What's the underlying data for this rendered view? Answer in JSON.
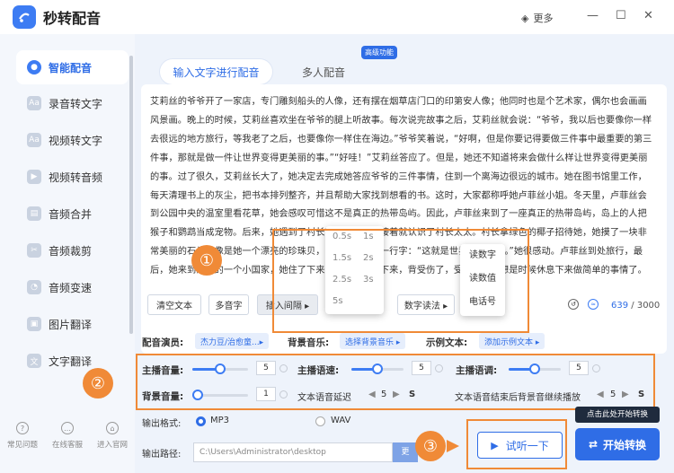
{
  "app": {
    "title": "秒转配音",
    "more_label": "更多",
    "win_controls": {
      "minimize": "—",
      "maximize": "☐",
      "close": "✕"
    }
  },
  "sidebar": {
    "items": [
      {
        "label": "智能配音",
        "icon": "mic-icon",
        "active": true
      },
      {
        "label": "录音转文字",
        "icon": "audio-text-icon"
      },
      {
        "label": "视频转文字",
        "icon": "video-text-icon"
      },
      {
        "label": "视频转音频",
        "icon": "video-audio-icon"
      },
      {
        "label": "音频合并",
        "icon": "merge-icon"
      },
      {
        "label": "音频裁剪",
        "icon": "scissors-icon"
      },
      {
        "label": "音频变速",
        "icon": "speed-icon"
      },
      {
        "label": "图片翻译",
        "icon": "image-translate-icon"
      },
      {
        "label": "文字翻译",
        "icon": "text-translate-icon"
      }
    ],
    "footer": [
      {
        "label": "常见问题",
        "icon": "question-icon"
      },
      {
        "label": "在线客服",
        "icon": "chat-icon"
      },
      {
        "label": "进入官网",
        "icon": "home-icon"
      }
    ]
  },
  "tabs": [
    {
      "label": "输入文字进行配音",
      "active": true
    },
    {
      "label": "多人配音"
    }
  ],
  "badge": "高级功能",
  "editor": {
    "text": "艾莉丝的爷爷开了一家店，专门雕刻船头的人像，还有摆在烟草店门口的印第安人像；他同时也是个艺术家，偶尔也会画画风景画。晚上的时候，艾莉丝喜欢坐在爷爷的腿上听故事。每次说完故事之后，艾莉丝就会说：“爷爷，我以后也要像你一样去很远的地方旅行，等我老了之后，也要像你一样住在海边。”爷爷笑着说，“好啊，但是你要记得要做三件事中最重要的第三件事，那就是做一件让世界变得更美丽的事。”“好哇！”艾莉丝答应了。但是，她还不知道将来会做什么样让世界变得更美丽的事。过了很久，艾莉丝长大了，她决定去完成她答应爷爷的三件事情，住到一个离海边很远的城市。她在图书馆里工作，每天清理书上的灰尘，把书本排列整齐，并且帮助大家找到想看的书。这时，大家都称呼她卢菲丝小姐。冬天里，卢菲丝会到公园中央的温室里看花草，她会感叹可惜这不是真正的热带岛屿。因此，卢菲丝来到了一座真正的热带岛屿，岛上的人把猴子和鹦鹉当成宠物。后来，她遇到了村长可怜的女儿，接着就认识了村长太太。村长拿绿色的椰子招待她，她摸了一块非常美丽的石头，像是她一个漂亮的珍珠贝，真是天堂岛和一行字：“这就是世界，就是你。”她很感动。卢菲丝到处旅行，最后，她来到东方的一个小国家，她住了下来，不小心摔了下来，背受伤了，受伤了。她想是时候休息下来做简单的事情了。",
    "buttons": {
      "clear": "清空文本",
      "polyphone": "多音字",
      "insert_pause": "插入间隔 ▸",
      "number_read": "数字读法 ▸"
    },
    "pause_options": [
      "0.5s",
      "1s",
      "1.5s",
      "2s",
      "2.5s",
      "3s",
      "5s"
    ],
    "number_options": [
      "读数字",
      "读数值",
      "电话号"
    ],
    "count": "639",
    "max": "/ 3000"
  },
  "settings": {
    "voice_label": "配音演员:",
    "voice_value": "杰力豆/治愈童...▸",
    "bgm_label": "背景音乐:",
    "bgm_value": "选择背景音乐 ▸",
    "sample_label": "示例文本:",
    "sample_value": "添加示例文本 ▸",
    "volume_label": "主播音量:",
    "volume_value": "5",
    "volume_level": 0.5,
    "speed_label": "主播语速:",
    "speed_value": "5",
    "speed_level": 0.5,
    "pitch_label": "主播语调:",
    "pitch_value": "5",
    "pitch_level": 0.5,
    "bg_volume_label": "背景音量:",
    "bg_volume_value": "1",
    "bg_volume_level": 0.1,
    "delay_label": "文本语音延迟",
    "delay_value": "5",
    "delay_unit": "S",
    "continue_label": "文本语音结束后背景音继续播放",
    "continue_value": "5",
    "continue_unit": "S"
  },
  "output": {
    "format_label": "输出格式:",
    "mp3": "MP3",
    "wav": "WAV",
    "path_label": "输出路径:",
    "path": "C:\\Users\\Administrator\\desktop",
    "browse": "更"
  },
  "actions": {
    "listen": "试听一下",
    "convert": "开始转换",
    "tooltip": "点击此处开始转换"
  },
  "annotations": [
    "①",
    "②",
    "③"
  ],
  "colors": {
    "accent": "#2f6de6",
    "highlight": "#f08a37"
  }
}
